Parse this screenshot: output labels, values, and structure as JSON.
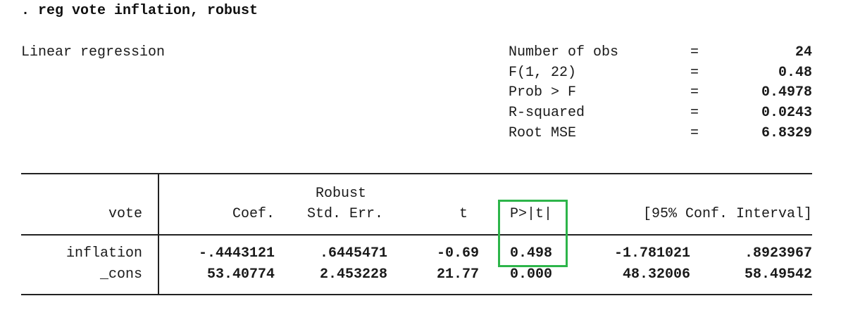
{
  "command": ". reg vote inflation, robust",
  "title": "Linear regression",
  "stats": [
    {
      "label": "Number of obs",
      "eq": "=",
      "value": "24"
    },
    {
      "label": "F(1, 22)",
      "eq": "=",
      "value": "0.48"
    },
    {
      "label": "Prob > F",
      "eq": "=",
      "value": "0.4978"
    },
    {
      "label": "R-squared",
      "eq": "=",
      "value": "0.0243"
    },
    {
      "label": "Root MSE",
      "eq": "=",
      "value": "6.8329"
    }
  ],
  "table": {
    "header_top": "Robust",
    "columns": [
      "vote",
      "Coef.",
      "Std. Err.",
      "t",
      "P>|t|",
      "[95% Conf. Interval]"
    ],
    "rows": [
      {
        "name": "inflation",
        "coef": "-.4443121",
        "se": ".6445471",
        "t": "-0.69",
        "p": "0.498",
        "ci_low": "-1.781021",
        "ci_high": ".8923967"
      },
      {
        "name": "_cons",
        "coef": "53.40774",
        "se": "2.453228",
        "t": "21.77",
        "p": "0.000",
        "ci_low": "48.32006",
        "ci_high": "58.49542"
      }
    ]
  },
  "highlight_color": "#2db54a"
}
